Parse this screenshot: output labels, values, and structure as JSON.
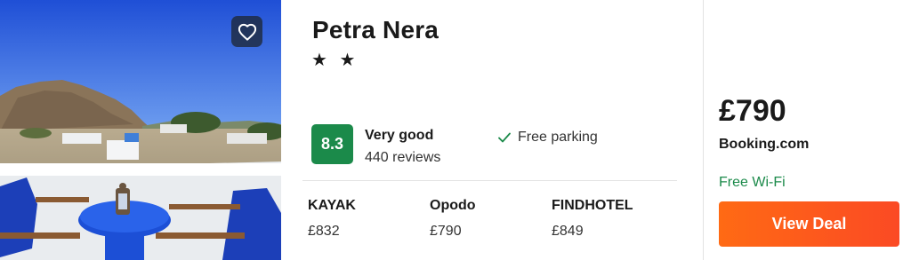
{
  "hotel": {
    "name": "Petra Nera",
    "stars_text": "★ ★"
  },
  "favorite": {
    "icon": "heart-icon"
  },
  "rating": {
    "score": "8.3",
    "label": "Very good",
    "reviews": "440 reviews",
    "badge_color": "#1b8a4a"
  },
  "amenities": [
    {
      "label": "Free parking",
      "icon": "check-icon"
    }
  ],
  "providers": [
    {
      "name": "KAYAK",
      "price": "£832"
    },
    {
      "name": "Opodo",
      "price": "£790"
    },
    {
      "name": "FINDHOTEL",
      "price": "£849"
    }
  ],
  "deal": {
    "price": "£790",
    "provider": "Booking.com",
    "perk": "Free Wi-Fi",
    "button_label": "View Deal",
    "button_color": "#ff5a1f",
    "perk_color": "#1b8a4a"
  }
}
